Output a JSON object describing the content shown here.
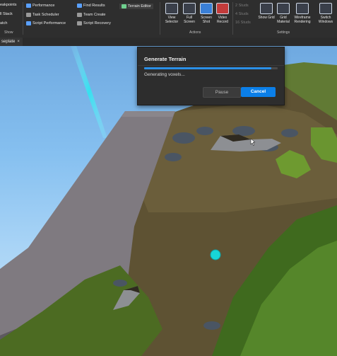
{
  "ribbon": {
    "left_items": [
      "eakpoints",
      "ll Stack",
      "atch"
    ],
    "left_group": "Show",
    "col2": [
      "Performance",
      "Task Scheduler",
      "Script Performance"
    ],
    "col3": [
      "Find Results",
      "Team Create",
      "Script Recovery"
    ],
    "col4": [
      "Terrain Editor"
    ],
    "view_selector": "View Selector",
    "full_screen": "Full Screen",
    "screen_shot": "Screen Shot",
    "video_record": "Video Record",
    "actions_group": "Actions",
    "studs": [
      "2 Studs",
      "4 Studs",
      "16 Studs"
    ],
    "show_grid": "Show Grid",
    "grid_material": "Grid Material",
    "wireframe": "Wireframe Rendering",
    "switch_windows": "Switch Windows",
    "settings_group": "Settings"
  },
  "tab": {
    "label": "seplate",
    "close": "×"
  },
  "dialog": {
    "title": "Generate Terrain",
    "status": "Generating voxels...",
    "progress_percent": 95,
    "pause_label": "Pause",
    "cancel_label": "Cancel"
  },
  "colors": {
    "accent": "#0b7fe8",
    "progress": "#2a8fe6",
    "marker": "#18d6d6"
  }
}
